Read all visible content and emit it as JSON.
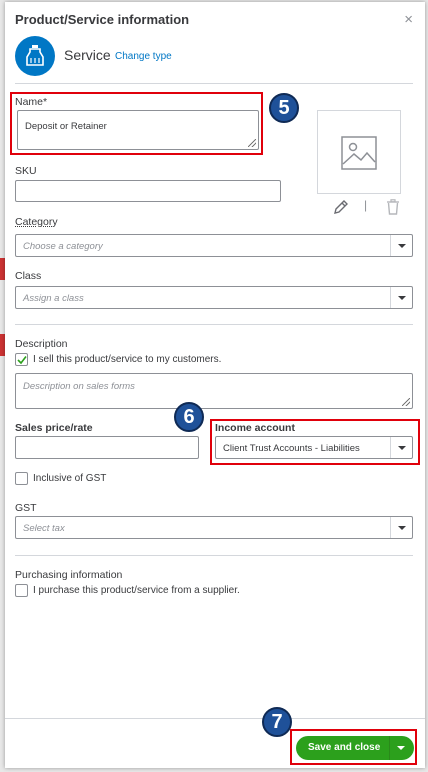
{
  "dialog": {
    "title": "Product/Service information",
    "close_glyph": "×",
    "type_label": "Service",
    "change_type_link": "Change type"
  },
  "fields": {
    "name": {
      "label": "Name*",
      "value": "Deposit or Retainer"
    },
    "sku": {
      "label": "SKU",
      "value": ""
    },
    "category": {
      "label": "Category",
      "placeholder": "Choose a category"
    },
    "class": {
      "label": "Class",
      "placeholder": "Assign a class"
    },
    "description": {
      "label": "Description",
      "sell_checkbox_label": "I sell this product/service to my customers.",
      "sell_checked": true,
      "placeholder": "Description on sales forms"
    },
    "sales_price": {
      "label": "Sales price/rate",
      "value": ""
    },
    "income_account": {
      "label": "Income account",
      "value": "Client Trust Accounts - Liabilities"
    },
    "inclusive_gst": {
      "label": "Inclusive of GST",
      "checked": false
    },
    "gst": {
      "label": "GST",
      "placeholder": "Select tax"
    },
    "purchasing": {
      "label": "Purchasing information",
      "checkbox_label": "I purchase this product/service from a supplier.",
      "checked": false
    }
  },
  "image": {
    "edit_icon": "pencil-icon",
    "separator": "|",
    "delete_icon": "trash-icon"
  },
  "annotations": {
    "step_5": "5",
    "step_6": "6",
    "step_7": "7"
  },
  "footer": {
    "save_label": "Save and close"
  },
  "colors": {
    "accent": "#0077c5",
    "save_green": "#2ca01c",
    "highlight_red": "#e0000b",
    "badge_blue": "#1f5199"
  }
}
